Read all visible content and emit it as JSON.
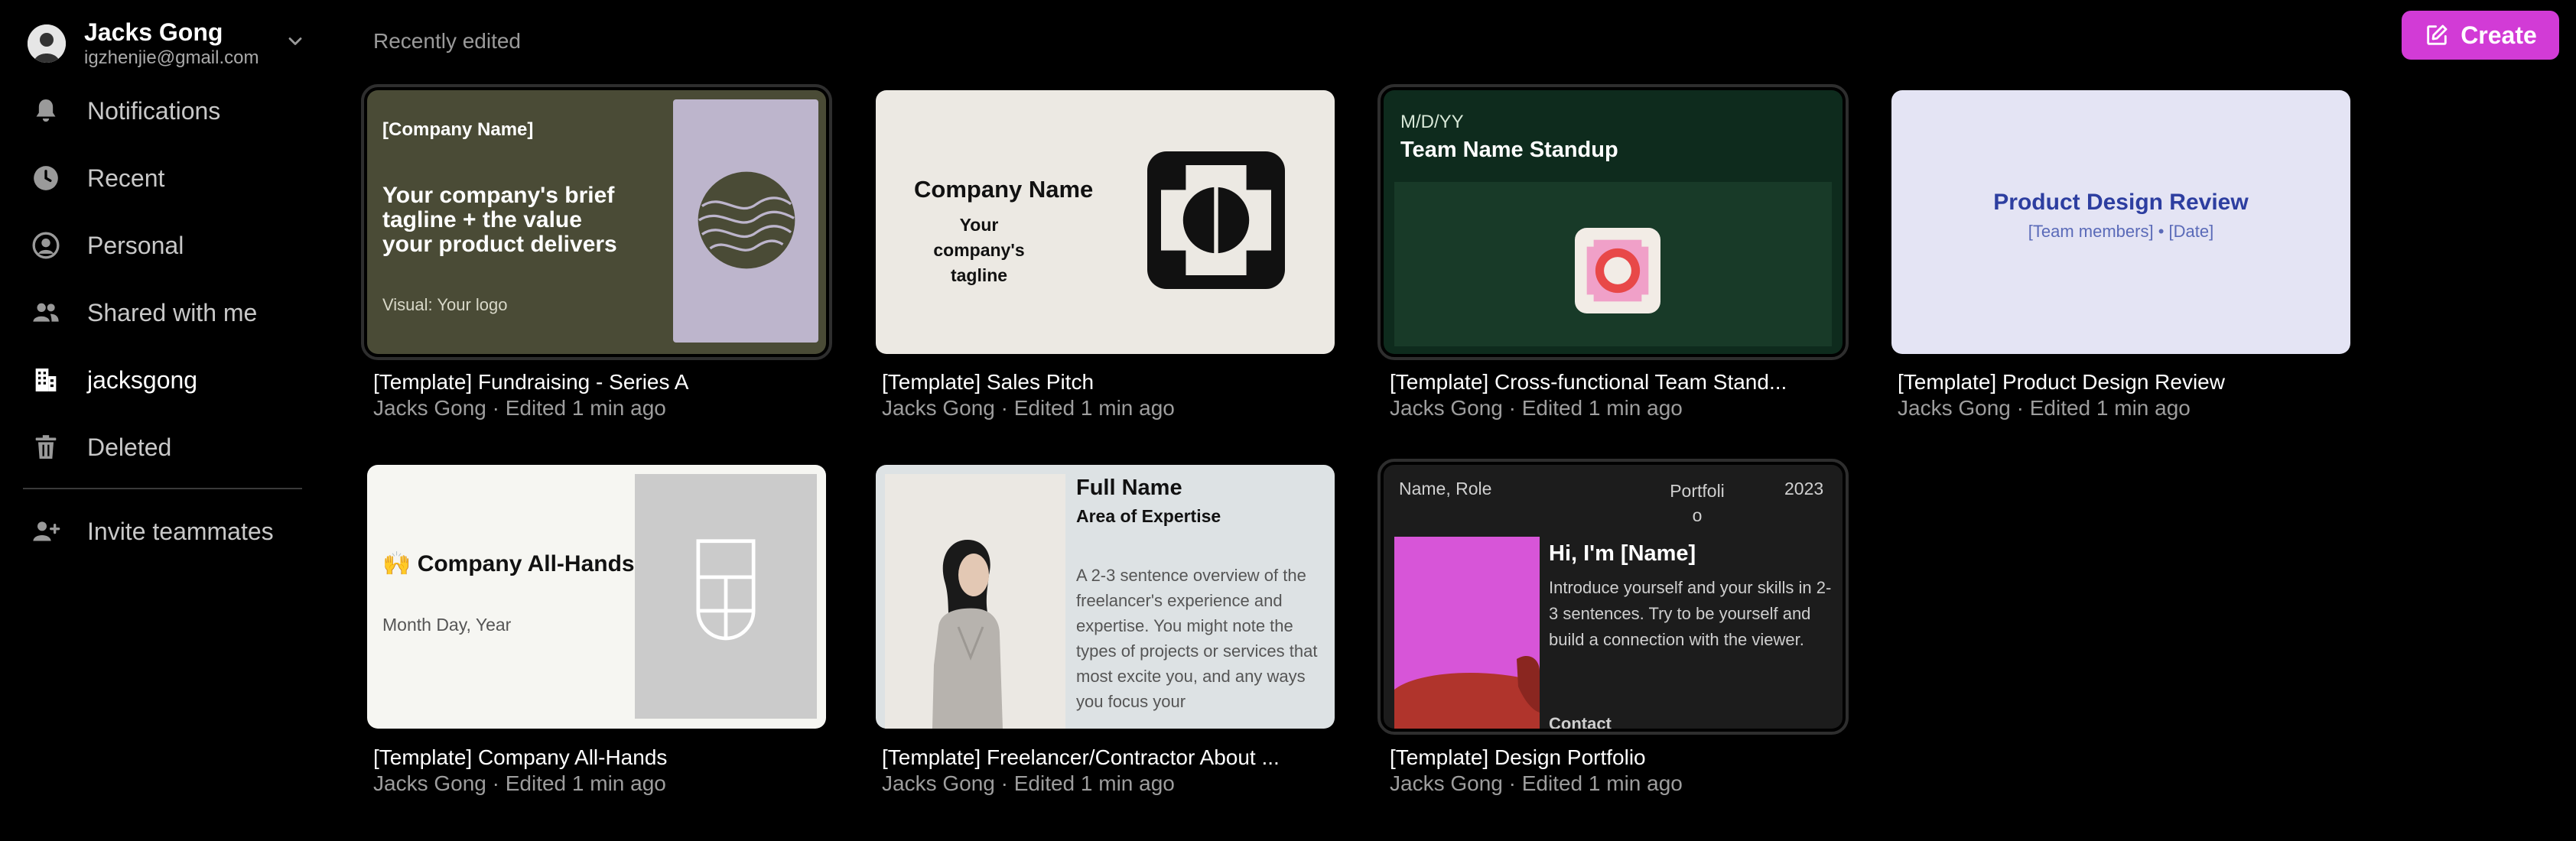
{
  "account": {
    "name": "Jacks Gong",
    "email": "igzhenjie@gmail.com"
  },
  "nav": {
    "items": [
      {
        "label": "Notifications",
        "icon": "bell-icon"
      },
      {
        "label": "Recent",
        "icon": "clock-icon"
      },
      {
        "label": "Personal",
        "icon": "user-circle-icon"
      },
      {
        "label": "Shared with me",
        "icon": "users-icon"
      },
      {
        "label": "jacksgong",
        "icon": "building-icon",
        "active": true
      },
      {
        "label": "Deleted",
        "icon": "trash-icon"
      }
    ],
    "invite_label": "Invite teammates"
  },
  "main": {
    "section_title": "Recently edited",
    "create_label": "Create"
  },
  "colors": {
    "accent": "#d23bd6",
    "background": "#000000"
  },
  "cards": [
    {
      "title": "[Template] Fundraising - Series A",
      "meta": "Jacks Gong · Edited 1 min ago",
      "thumb": {
        "company": "[Company Name]",
        "tagline": "Your company's brief tagline + the value your product delivers",
        "visual": "Visual: Your logo"
      }
    },
    {
      "title": "[Template] Sales Pitch",
      "meta": "Jacks Gong · Edited 1 min ago",
      "thumb": {
        "company": "Company Name",
        "tagline": "Your company's tagline"
      }
    },
    {
      "title": "[Template] Cross-functional Team Stand...",
      "meta": "Jacks Gong · Edited 1 min ago",
      "thumb": {
        "date": "M/D/YY",
        "title": "Team Name Standup"
      }
    },
    {
      "title": "[Template] Product Design Review",
      "meta": "Jacks Gong · Edited 1 min ago",
      "thumb": {
        "title": "Product Design Review",
        "subtitle": "[Team members] • [Date]"
      }
    },
    {
      "title": "[Template] Company All-Hands",
      "meta": "Jacks Gong · Edited 1 min ago",
      "thumb": {
        "title": "🙌 Company All-Hands",
        "date": "Month Day, Year"
      }
    },
    {
      "title": "[Template] Freelancer/Contractor About ...",
      "meta": "Jacks Gong · Edited 1 min ago",
      "thumb": {
        "name": "Full Name",
        "area": "Area of Expertise",
        "description": "A 2-3 sentence overview of the freelancer's experience and expertise. You might note the types of projects or services that most excite you, and any ways you focus your"
      }
    },
    {
      "title": "[Template] Design Portfolio",
      "meta": "Jacks Gong · Edited 1 min ago",
      "thumb": {
        "name_role": "Name, Role",
        "portfolio": "Portfolio",
        "year": "2023",
        "heading": "Hi, I'm [Name]",
        "intro": "Introduce yourself and your skills in 2-3 sentences. Try to be yourself and build a connection with the viewer.",
        "contact": "Contact"
      }
    }
  ]
}
